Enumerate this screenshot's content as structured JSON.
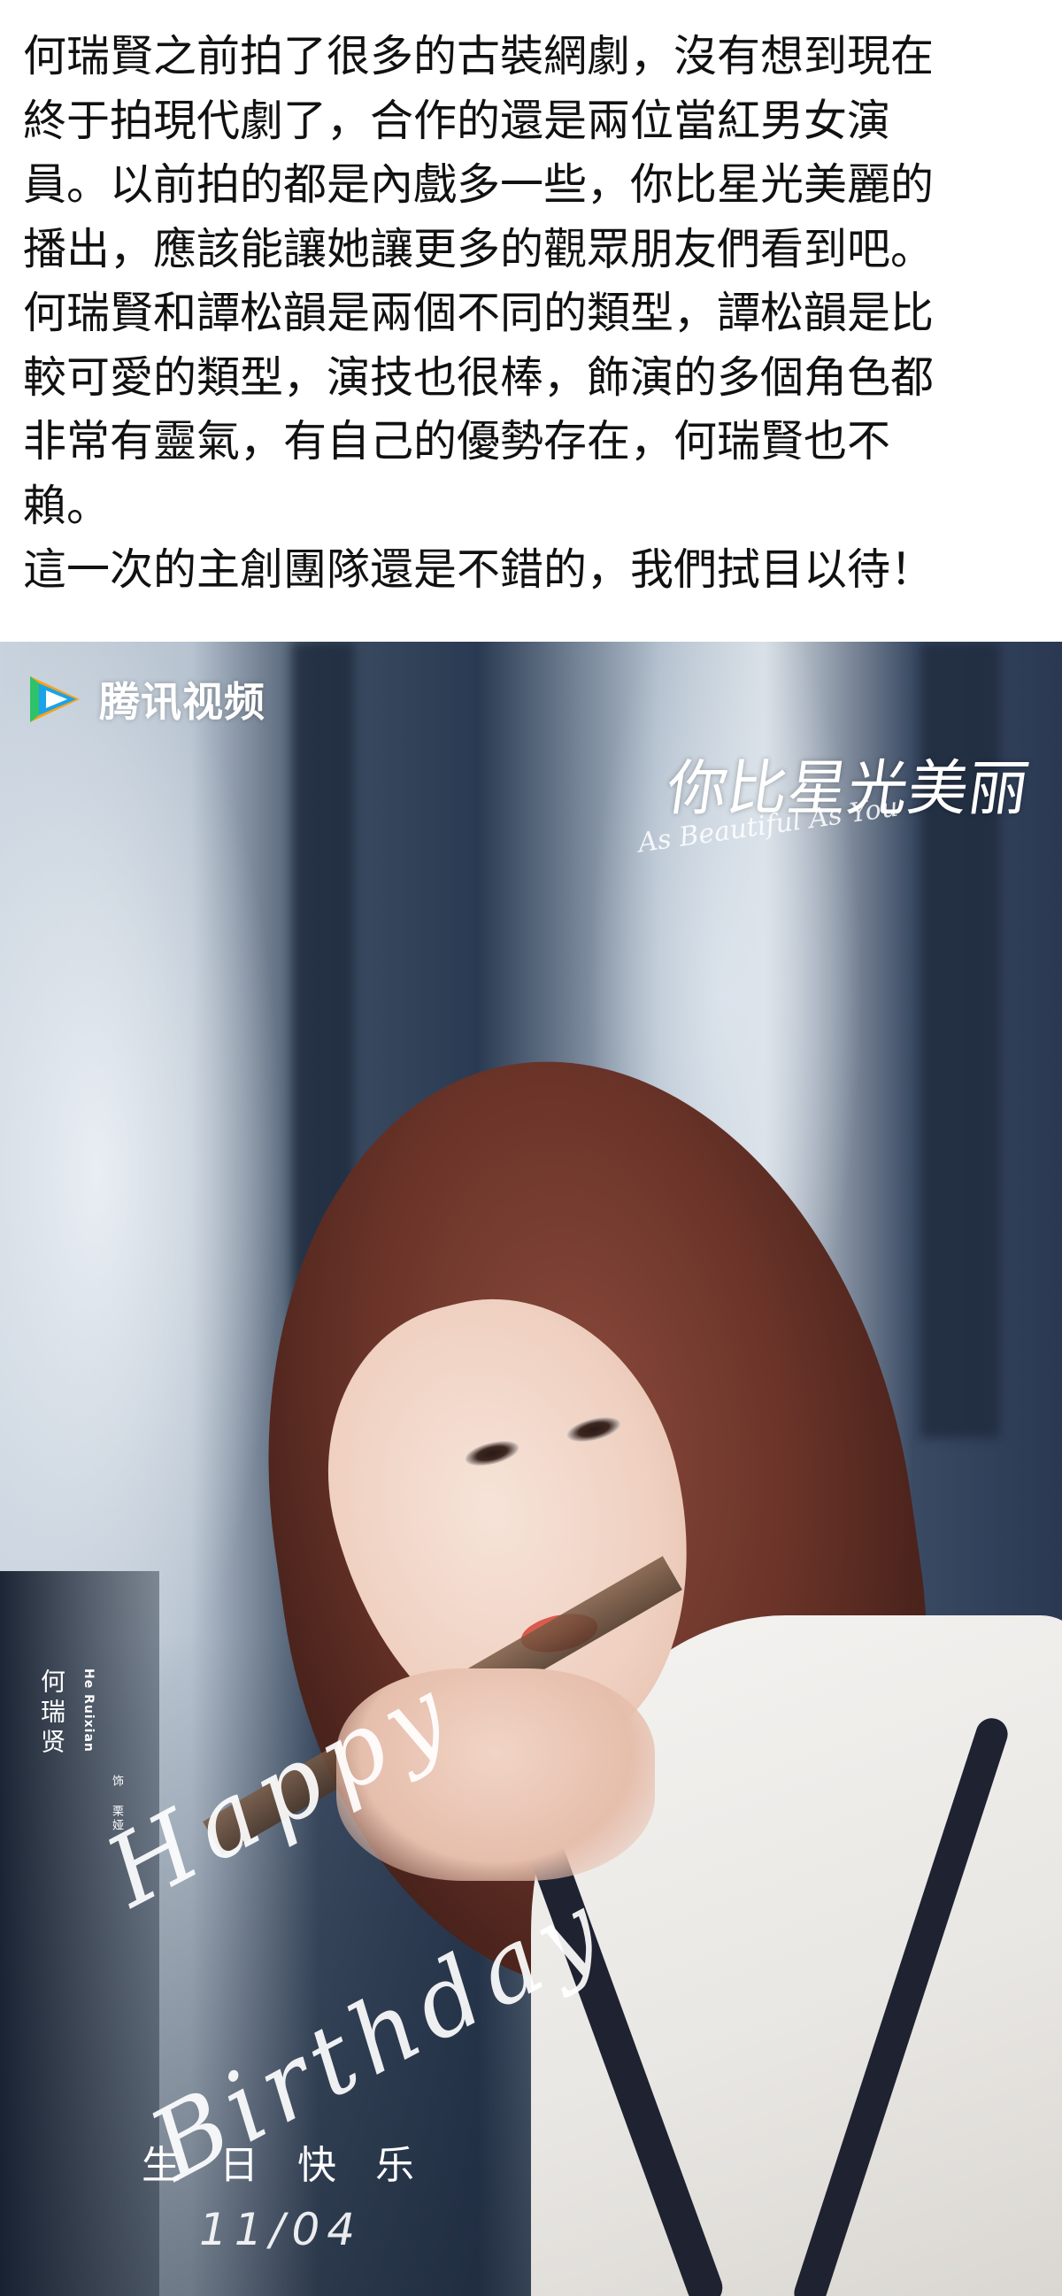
{
  "article": {
    "lines": [
      "何瑞賢之前拍了很多的古裝網劇，沒有想到現在",
      "終于拍現代劇了，合作的還是兩位當紅男女演",
      "員。以前拍的都是內戲多一些，你比星光美麗的",
      "播出，應該能讓她讓更多的觀眾朋友們看到吧。",
      "何瑞賢和譚松韻是兩個不同的類型，譚松韻是比",
      "較可愛的類型，演技也很棒，飾演的多個角色都",
      "非常有靈氣，有自己的優勢存在，何瑞賢也不",
      "賴。",
      "這一次的主創團隊還是不錯的，我們拭目以待！"
    ]
  },
  "poster": {
    "logo_text": "腾讯视频",
    "logo_icon": "tencent-video-play-icon",
    "logo_colors": [
      "#f7a21b",
      "#1aa3e8",
      "#2ec26a"
    ],
    "drama_title_cn": "你比星光美丽",
    "drama_title_en": "As Beautiful As You",
    "actor_name": "何瑞贤",
    "actor_name_en": "He Ruixian",
    "role_label": "饰 栗娅",
    "greeting_en_1": "Happy",
    "greeting_en_2": "Birthday",
    "greeting_cn": "生日快乐",
    "date": "11/04"
  }
}
